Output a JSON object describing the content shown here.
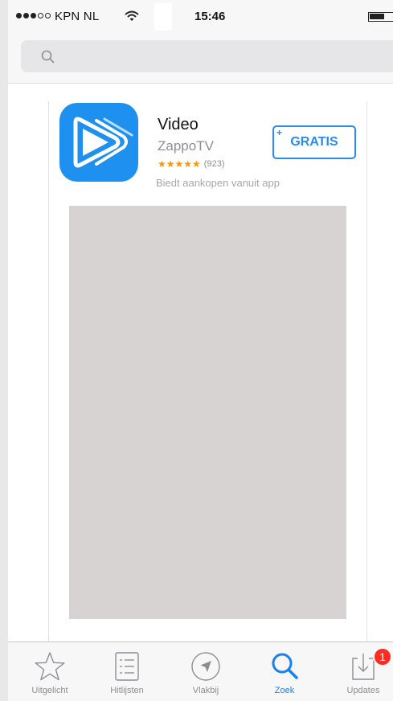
{
  "status_bar": {
    "carrier": "KPN NL",
    "time": "15:46",
    "signal_bars_filled": 3,
    "signal_bars_total": 5
  },
  "search": {
    "placeholder": ""
  },
  "app": {
    "title": "Video",
    "developer": "ZappoTV",
    "stars": "★★★★★",
    "rating_count": "(923)",
    "in_app_note": "Biedt aankopen vanuit app",
    "get_button_label": "GRATIS",
    "get_button_plus": "+",
    "icon_color": "#1e90ef"
  },
  "tabs": [
    {
      "label": "Uitgelicht",
      "icon": "star-icon"
    },
    {
      "label": "Hitlijsten",
      "icon": "list-icon"
    },
    {
      "label": "Vlakbij",
      "icon": "location-icon"
    },
    {
      "label": "Zoek",
      "icon": "search-icon",
      "active": true
    },
    {
      "label": "Updates",
      "icon": "updates-icon",
      "badge": "1"
    }
  ],
  "colors": {
    "accent": "#1a7ff2",
    "badge": "#ff2d21",
    "star": "#ff9500"
  }
}
